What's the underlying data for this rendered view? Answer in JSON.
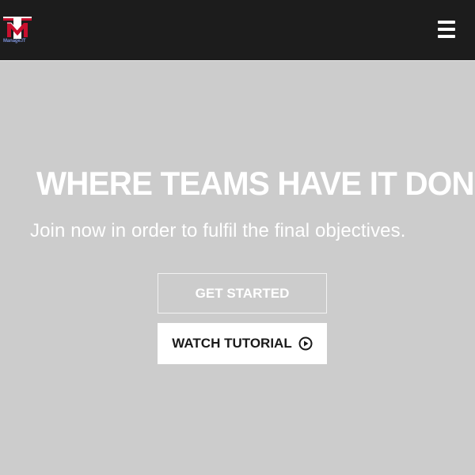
{
  "header": {
    "logo_text": "Manage.IT",
    "logo_letters": "TM",
    "logo_icon": "brand-logo-icon",
    "menu_icon": "hamburger-menu-icon"
  },
  "hero": {
    "title": "WHERE TEAMS HAVE IT DONE",
    "subtitle": "Join now in order to fulfil the final objectives.",
    "primary_button": "GET STARTED",
    "secondary_button": "WATCH TUTORIAL",
    "secondary_button_icon": "play-circle-icon"
  },
  "colors": {
    "header_bg": "#1c1c1c",
    "page_bg": "#cccccc",
    "logo_red": "#c8102e",
    "logo_blue": "#7b90d6",
    "text_light": "#ffffff",
    "text_dark": "#1a1a1a"
  }
}
